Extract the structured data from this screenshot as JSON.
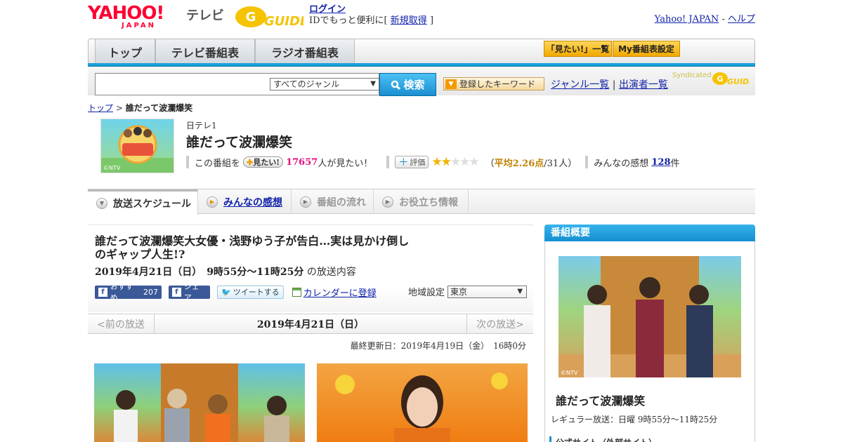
{
  "header": {
    "yahoo_logo": "YAHOO!",
    "japan_logo": "JAPAN",
    "tv_label": "テレビ",
    "gguide_logo": "GUIDE",
    "login_link": "ログイン",
    "login_desc": "IDでもっと便利に[",
    "signup_link": "新規取得",
    "signup_close": "]",
    "yahoo_japan_link": "Yahoo! JAPAN",
    "separator": "-",
    "help_link": "ヘルプ"
  },
  "nav": {
    "tabs": [
      "トップ",
      "テレビ番組表",
      "ラジオ番組表"
    ],
    "mitai_list": "「見たい!」一覧",
    "my_schedule": "My番組表設定"
  },
  "search": {
    "genre_selected": "すべてのジャンル",
    "search_button": "検索",
    "keyword_button": "登録したキーワード",
    "genre_list_link": "ジャンル一覧",
    "divider": "|",
    "performer_link": "出演者一覧",
    "syndicated": "Syndicated"
  },
  "breadcrumb": {
    "top": "トップ",
    "sep": ">",
    "current": "誰だって波瀾爆笑"
  },
  "program": {
    "image_credit": "©NTV",
    "channel": "日テレ1",
    "title": "誰だって波瀾爆笑",
    "mitai_prefix": "この番組を",
    "mitai_button": "見たい!",
    "mitai_count": "17657",
    "mitai_suffix": "人が見たい！",
    "eval_button": "評価",
    "rating_open": "（",
    "rating_avg": "平均2.26点",
    "rating_count": "/31人）",
    "impressions_label": "みんなの感想",
    "impressions_count": "128",
    "impressions_unit": "件",
    "rating_value": 2.26,
    "rating_max": 5
  },
  "tabs": [
    {
      "label": "放送スケジュール"
    },
    {
      "label": "みんなの感想"
    },
    {
      "label": "番組の流れ"
    },
    {
      "label": "お役立ち情報"
    }
  ],
  "episode": {
    "title": "誰だって波瀾爆笑大女優・浅野ゆう子が告白…実は見かけ倒しのギャップ人生!?",
    "date": "2019年4月21日（日）　9時55分～11時25分",
    "date_suffix": "の放送内容",
    "fb_recommend": "おすすめ",
    "fb_count": "207",
    "fb_share": "シェア",
    "tweet": "ツイートする",
    "calendar": "カレンダーに登録",
    "region_label": "地域設定",
    "region_value": "東京"
  },
  "date_nav": {
    "prev": "<前の放送",
    "current": "2019年4月21日（日）",
    "next": "次の放送>"
  },
  "updated": "最終更新日：2019年4月19日（金）　16時0分",
  "photo_credit": "©NTV",
  "sidebar": {
    "header": "番組概要",
    "title": "誰だって波瀾爆笑",
    "regular": "レギュラー放送：日曜 9時55分～11時25分",
    "official": "公式サイト（外部サイト）"
  }
}
